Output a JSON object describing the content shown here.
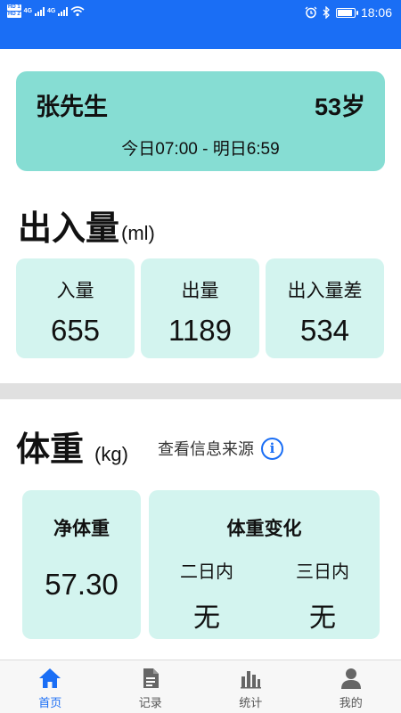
{
  "status_bar": {
    "sim1": "HD 1",
    "sim2": "HD 2",
    "net1": "4G",
    "net2": "4G",
    "time": "18:06",
    "battery_level": 0.8
  },
  "patient": {
    "name": "张先生",
    "age": "53岁",
    "period": "今日07:00 - 明日6:59"
  },
  "intake_output": {
    "title": "出入量",
    "unit": "(ml)",
    "cards": [
      {
        "label": "入量",
        "value": "655"
      },
      {
        "label": "出量",
        "value": "1189"
      },
      {
        "label": "出入量差",
        "value": "534"
      }
    ]
  },
  "weight": {
    "title": "体重",
    "unit": "(kg)",
    "source_link": "查看信息来源",
    "net": {
      "label": "净体重",
      "value": "57.30"
    },
    "change": {
      "title": "体重变化",
      "cols": [
        {
          "label": "二日内",
          "value": "无"
        },
        {
          "label": "三日内",
          "value": "无"
        }
      ]
    }
  },
  "tabs": [
    {
      "label": "首页",
      "icon": "home-icon",
      "active": true
    },
    {
      "label": "记录",
      "icon": "document-icon",
      "active": false
    },
    {
      "label": "统计",
      "icon": "bar-chart-icon",
      "active": false
    },
    {
      "label": "我的",
      "icon": "user-icon",
      "active": false
    }
  ],
  "colors": {
    "primary": "#1a6ef5",
    "card_teal": "#86ddd3",
    "card_light": "#d3f4ef"
  }
}
